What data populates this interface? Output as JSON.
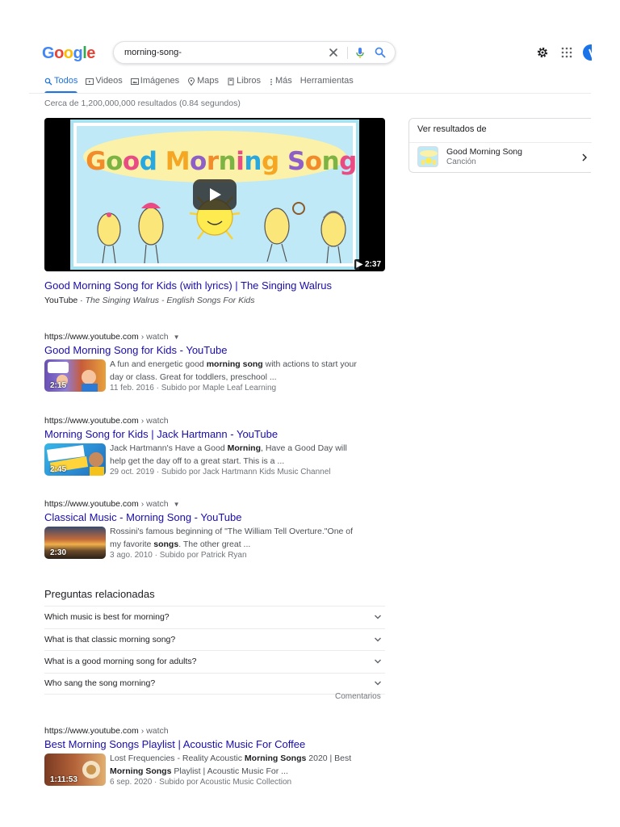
{
  "header": {
    "logo_text": "Google",
    "logo_letters": [
      {
        "c": "G",
        "color": "#4285f4"
      },
      {
        "c": "o",
        "color": "#ea4335"
      },
      {
        "c": "o",
        "color": "#fbbc05"
      },
      {
        "c": "g",
        "color": "#4285f4"
      },
      {
        "c": "l",
        "color": "#34a853"
      },
      {
        "c": "e",
        "color": "#ea4335"
      }
    ],
    "search_value": "morning-song-",
    "icons": {
      "clear": "close-icon",
      "mic": "mic-icon",
      "search": "search-icon",
      "settings": "gear-icon",
      "apps": "apps-grid-icon"
    }
  },
  "tabs": [
    {
      "label": "Todos",
      "icon": "search-icon",
      "active": true
    },
    {
      "label": "Videos",
      "icon": "video-icon",
      "active": false
    },
    {
      "label": "Imágenes",
      "icon": "image-icon",
      "active": false
    },
    {
      "label": "Maps",
      "icon": "map-pin-icon",
      "active": false
    },
    {
      "label": "Libros",
      "icon": "book-icon",
      "active": false
    },
    {
      "label": "Más",
      "icon": "more-vert-icon",
      "active": false
    },
    {
      "label": "Herramientas",
      "icon": "",
      "active": false
    }
  ],
  "stats": "Cerca de 1,200,000,000 resultados (0.84 segundos)",
  "video_result": {
    "thumbnail_title": "Good Morning Song",
    "thumbnail_title_colors": [
      "#f28b2a",
      "#7cb342",
      "#e94b83",
      "#29a8e0",
      "#f5a623",
      "#8e5fc7"
    ],
    "duration": "2:37",
    "title": "Good Morning Song for Kids (with lyrics) | The Singing Walrus",
    "source": "YouTube",
    "channel": "The Singing Walrus - English Songs For Kids"
  },
  "results": [
    {
      "url": "https://www.youtube.com",
      "path": "› watch",
      "has_menu": true,
      "title": "Good Morning Song for Kids - YouTube",
      "duration": "2:15",
      "snippet_html": "A fun and energetic good <b>morning song</b> with actions to start your day or class. Great for toddlers, preschool ...",
      "meta": "11 feb. 2016 · Subido por Maple Leaf Learning"
    },
    {
      "url": "https://www.youtube.com",
      "path": "› watch",
      "has_menu": false,
      "title": "Morning Song for Kids | Jack Hartmann - YouTube",
      "duration": "2:45",
      "snippet_html": "Jack Hartmann's Have a Good <b>Morning</b>, Have a Good Day will help get the day off to a great start. This is a ...",
      "meta": "29 oct. 2019 · Subido por Jack Hartmann Kids Music Channel"
    },
    {
      "url": "https://www.youtube.com",
      "path": "› watch",
      "has_menu": true,
      "title": "Classical Music - Morning Song - YouTube",
      "duration": "2:30",
      "snippet_html": "Rossini's famous beginning of \"The William Tell Overture.\"One of my favorite <b>songs</b>. The other great ...",
      "meta": "3 ago. 2010 · Subido por Patrick Ryan"
    }
  ],
  "paa": {
    "heading": "Preguntas relacionadas",
    "questions": [
      "Which music is best for morning?",
      "What is that classic morning song?",
      "What is a good morning song for adults?",
      "Who sang the song morning?"
    ],
    "feedback": "Comentarios"
  },
  "last_result": {
    "url": "https://www.youtube.com",
    "path": "› watch",
    "title": "Best Morning Songs Playlist | Acoustic Music For Coffee",
    "duration": "1:11:53",
    "snippet_html": "Lost Frequencies - Reality Acoustic <b>Morning Songs</b> 2020 | Best <b>Morning Songs</b> Playlist | Acoustic Music For ...",
    "meta": "6 sep. 2020 · Subido por Acoustic Music Collection"
  },
  "knowledge_panel": {
    "heading": "Ver resultados de",
    "title": "Good Morning Song",
    "subtitle": "Canción"
  }
}
